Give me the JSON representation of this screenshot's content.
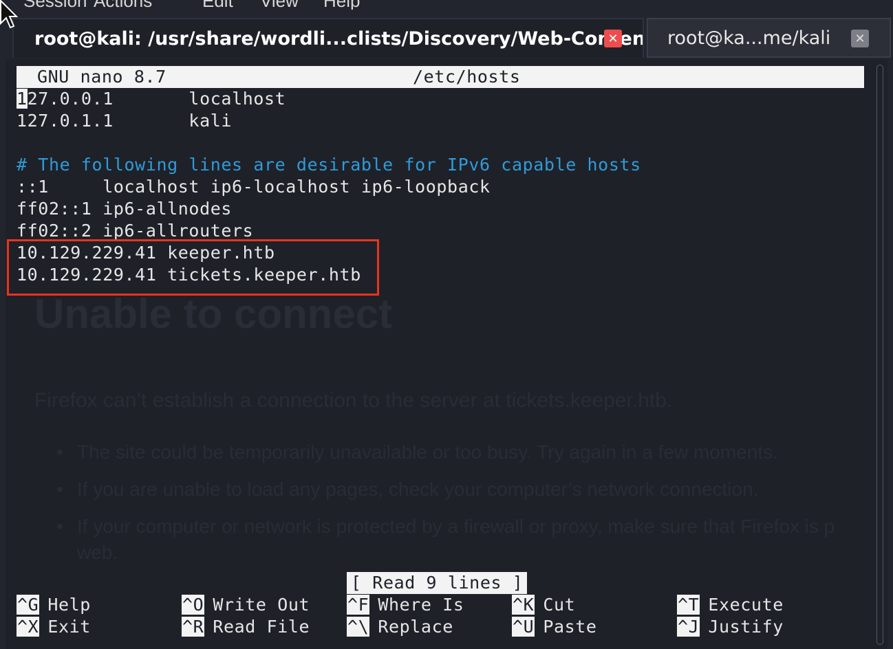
{
  "menu": [
    "Session",
    "Actions",
    "Edit",
    "View",
    "Help"
  ],
  "tabs": [
    {
      "label": "root@kali: /usr/share/wordli...clists/Discovery/Web-Content",
      "close": "✕"
    },
    {
      "label": "root@ka...me/kali",
      "close": "✕"
    }
  ],
  "nano": {
    "version": "GNU nano 8.7",
    "filename": "/etc/hosts",
    "lines": [
      {
        "ip": "27.0.0.1",
        "ip_first_char": "1",
        "host": "       localhost"
      },
      {
        "text": "127.0.1.1       kali"
      },
      {
        "text": ""
      },
      {
        "comment": "# The following lines are desirable for IPv6 capable hosts"
      },
      {
        "text": "::1     localhost ip6-localhost ip6-loopback"
      },
      {
        "text": "ff02::1 ip6-allnodes"
      },
      {
        "text": "ff02::2 ip6-allrouters"
      },
      {
        "text": "10.129.229.41 keeper.htb"
      },
      {
        "text": "10.129.229.41 tickets.keeper.htb"
      }
    ],
    "status": "[ Read 9 lines ]",
    "shortcuts": [
      {
        "key": "^G",
        "label": "Help"
      },
      {
        "key": "^X",
        "label": "Exit"
      },
      {
        "key": "^O",
        "label": "Write Out"
      },
      {
        "key": "^R",
        "label": "Read File"
      },
      {
        "key": "^F",
        "label": "Where Is"
      },
      {
        "key": "^\\",
        "label": "Replace"
      },
      {
        "key": "^K",
        "label": "Cut"
      },
      {
        "key": "^U",
        "label": "Paste"
      },
      {
        "key": "^T",
        "label": "Execute"
      },
      {
        "key": "^J",
        "label": "Justify"
      }
    ]
  },
  "background_page": {
    "title": "Unable to connect",
    "message": "Firefox can’t establish a connection to the server at tickets.keeper.htb.",
    "bullets": [
      "The site could be temporarily unavailable or too busy. Try again in a few moments.",
      "If you are unable to load any pages, check your computer’s network connection.",
      "If your computer or network is protected by a firewall or proxy, make sure that Firefox is p"
    ],
    "bullet_tail": "web."
  },
  "colors": {
    "comment": "#2f9bd8",
    "highlight": "#e8341f",
    "background": "#1f2129"
  }
}
